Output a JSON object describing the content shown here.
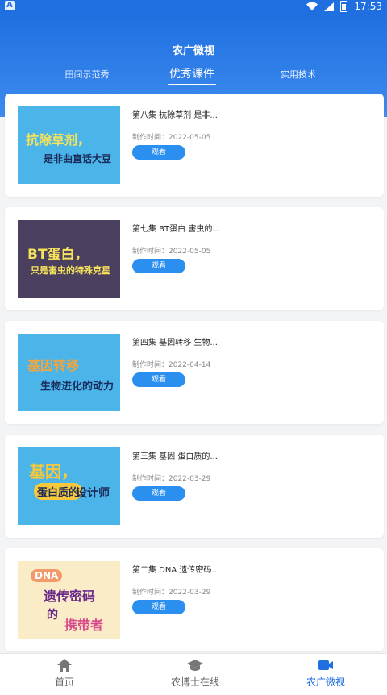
{
  "status_bar": {
    "time": "17:53"
  },
  "header": {
    "title": "农广微视"
  },
  "tabs": [
    {
      "label": "田间示范秀"
    },
    {
      "label": "优秀课件",
      "active": true
    },
    {
      "label": "实用技术"
    }
  ],
  "cards": [
    {
      "title": "第八集 抗除草剂 是非...",
      "date": "制作时间：2022-05-05",
      "button": "观看",
      "thumb_lines": [
        "抗除草剂，",
        "是非曲直话大豆"
      ],
      "thumb_bg": "#4bb4e8"
    },
    {
      "title": "第七集 BT蛋白 害虫的...",
      "date": "制作时间：2022-05-05",
      "button": "观看",
      "thumb_lines": [
        "BT蛋白，",
        "只是害虫的特殊克星"
      ],
      "thumb_bg": "#4a3f5e"
    },
    {
      "title": "第四集 基因转移 生物...",
      "date": "制作时间：2022-04-14",
      "button": "观看",
      "thumb_lines": [
        "基因转移",
        "生物进化的动力"
      ],
      "thumb_bg": "#4bb4e8"
    },
    {
      "title": "第三集 基因 蛋白质的...",
      "date": "制作时间：2022-03-29",
      "button": "观看",
      "thumb_lines": [
        "基因，",
        "蛋白质的",
        "设计师"
      ],
      "thumb_bg": "#4bb4e8"
    },
    {
      "title": "第二集 DNA 遗传密码...",
      "date": "制作时间：2022-03-29",
      "button": "观看",
      "thumb_lines": [
        "DNA",
        "遗传密码",
        "的",
        "携带者"
      ],
      "thumb_bg": "#fbecc8"
    }
  ],
  "nav": [
    {
      "label": "首页",
      "icon": "home-icon"
    },
    {
      "label": "农博士在线",
      "icon": "graduation-cap-icon"
    },
    {
      "label": "农广微视",
      "icon": "video-camera-icon",
      "active": true
    }
  ],
  "colors": {
    "primary": "#1f6fe0",
    "button": "#2b8ff0",
    "page_bg": "#f3f4f6"
  }
}
